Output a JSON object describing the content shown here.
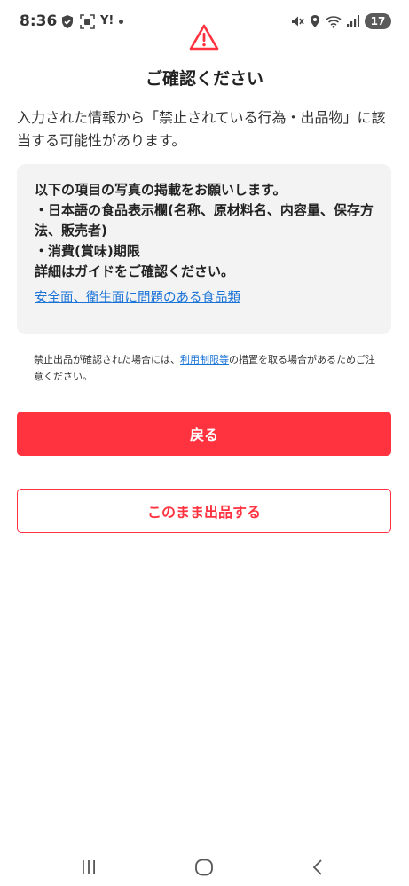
{
  "status_bar": {
    "time": "8:36",
    "left_icons": [
      "shield-check-icon",
      "screenshot-icon",
      "yahoo-icon",
      "dot-icon"
    ],
    "yahoo_text": "Y!",
    "right_icons": [
      "mute-icon",
      "location-icon",
      "wifi-icon",
      "signal-icon",
      "battery-icon"
    ],
    "battery_level": "17"
  },
  "dialog": {
    "icon": "warning-triangle-icon",
    "title": "ご確認ください",
    "lead": "入力された情報から「禁止されている行為・出品物」に該当する可能性があります。",
    "info_box": {
      "lines": [
        "以下の項目の写真の掲載をお願いします。",
        "・日本語の食品表示欄(名称、原材料名、内容量、保存方法、販売者)",
        "・消費(賞味)期限",
        "詳細はガイドをご確認ください。"
      ],
      "link_label": "安全面、衛生面に問題のある食品類"
    },
    "notice": {
      "before": "禁止出品が確認された場合には、",
      "link_label": "利用制限等",
      "after": "の措置を取る場合があるためご注意ください。"
    },
    "back_button_label": "戻る",
    "continue_button_label": "このまま出品する"
  },
  "nav_bar": {
    "buttons": [
      "recent-apps-icon",
      "home-icon",
      "back-icon"
    ]
  },
  "colors": {
    "accent": "#ff3340",
    "link": "#1a73d6",
    "info_bg": "#f3f3f3",
    "text": "#222222"
  }
}
